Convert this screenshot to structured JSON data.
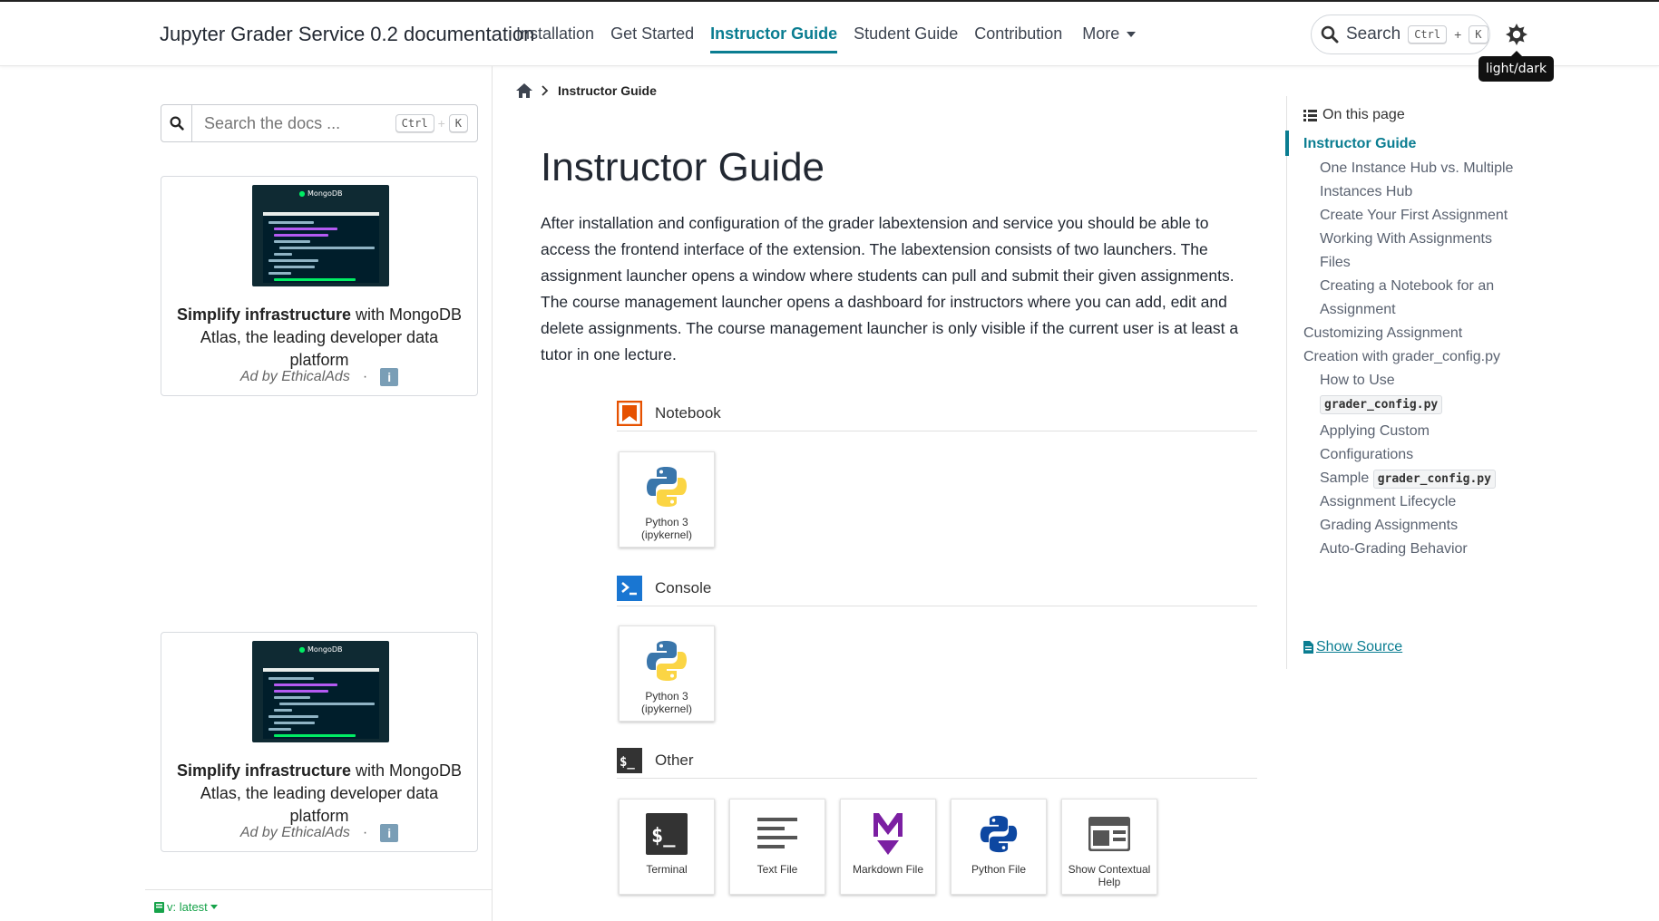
{
  "header": {
    "site_title": "Jupyter Grader Service 0.2 documentation",
    "nav": [
      {
        "label": "Installation",
        "active": false
      },
      {
        "label": "Get Started",
        "active": false
      },
      {
        "label": "Instructor Guide",
        "active": true
      },
      {
        "label": "Student Guide",
        "active": false
      },
      {
        "label": "Contribution",
        "active": false
      }
    ],
    "more_label": "More",
    "search_label": "Search",
    "search_keys": [
      "Ctrl",
      "K"
    ],
    "search_plus": "+",
    "theme_tooltip": "light/dark",
    "accent_color": "#0a7d91"
  },
  "sidebar": {
    "search_placeholder": "Search the docs ...",
    "search_keys": [
      "Ctrl",
      "K"
    ],
    "search_plus": "+",
    "ads": [
      {
        "logo": "MongoDB",
        "headline_bold": "Simplify infrastructure",
        "headline_rest": " with MongoDB Atlas, the leading developer data platform",
        "ad_by": "Ad by EthicalAds",
        "separator": "·",
        "info": "i"
      },
      {
        "logo": "MongoDB",
        "headline_bold": "Simplify infrastructure",
        "headline_rest": " with MongoDB Atlas, the leading developer data platform",
        "ad_by": "Ad by EthicalAds",
        "separator": "·",
        "info": "i"
      }
    ],
    "version": "v: latest"
  },
  "main": {
    "breadcrumb_current": "Instructor Guide",
    "title": "Instructor Guide",
    "intro": "After installation and configuration of the grader labextension and service you should be able to access the frontend interface of the extension. The labextension consists of two launchers. The assignment launcher opens a window where students can pull and submit their given assignments. The course management launcher opens a dashboard for instructors where you can add, edit and delete assignments. The course management launcher is only visible if the current user is at least a tutor in one lecture.",
    "launcher": {
      "notebook_title": "Notebook",
      "notebook_card": "Python 3 (ipykernel)",
      "console_title": "Console",
      "console_card": "Python 3 (ipykernel)",
      "other_title": "Other",
      "other_cards": [
        "Terminal",
        "Text File",
        "Markdown File",
        "Python File",
        "Show Contextual Help"
      ],
      "terminal_glyph": "$_"
    }
  },
  "toc": {
    "heading": "On this page",
    "items": [
      {
        "label": "Instructor Guide"
      },
      {
        "label": "One Instance Hub vs. Multiple Instances Hub"
      },
      {
        "label": "Create Your First Assignment"
      },
      {
        "label": "Working With Assignments"
      },
      {
        "label": "Files"
      },
      {
        "label": "Creating a Notebook for an Assignment"
      },
      {
        "label": "Customizing Assignment Creation with grader_config.py"
      },
      {
        "label": "How to Use"
      },
      {
        "label": "grader_config.py"
      },
      {
        "label": "Applying Custom Configurations"
      },
      {
        "label": "Sample"
      },
      {
        "label": "grader_config.py"
      },
      {
        "label": "Assignment Lifecycle"
      },
      {
        "label": "Grading Assignments"
      },
      {
        "label": "Auto-Grading Behavior"
      }
    ],
    "show_source": "Show Source"
  }
}
